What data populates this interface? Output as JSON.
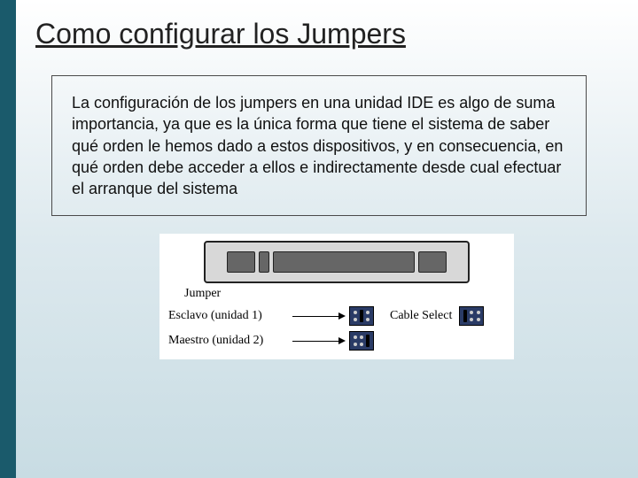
{
  "title": "Como configurar los Jumpers",
  "body_text": "La configuración de los jumpers en una unidad IDE es algo de suma importancia, ya que es la única forma que tiene el sistema de saber qué orden le hemos dado a estos dispositivos, y en consecuencia, en qué orden debe acceder a ellos e indirectamente desde cual efectuar el arranque del sistema",
  "diagram": {
    "jumper_label": "Jumper",
    "rows": [
      {
        "label": "Esclavo (unidad 1)"
      },
      {
        "label": "Maestro (unidad 2)"
      }
    ],
    "cable_select_label": "Cable Select"
  }
}
